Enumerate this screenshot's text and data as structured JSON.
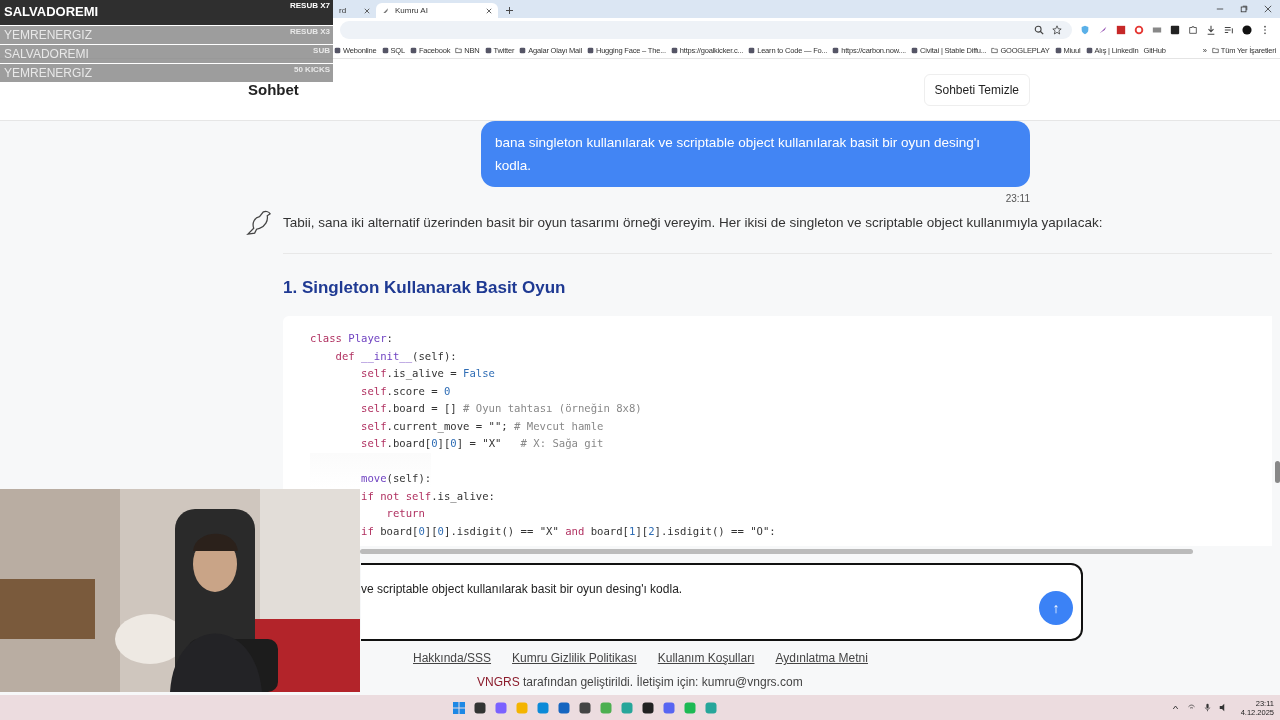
{
  "browser": {
    "tabs": [
      {
        "label": "rd",
        "selected": false
      },
      {
        "label": "Kumru AI",
        "selected": true
      }
    ],
    "bookmarks": [
      {
        "label": "Webonline",
        "kind": "site"
      },
      {
        "label": "SQL",
        "kind": "site"
      },
      {
        "label": "Facebook",
        "kind": "site"
      },
      {
        "label": "NBN",
        "kind": "folder"
      },
      {
        "label": "Twitter",
        "kind": "site"
      },
      {
        "label": "Agalar Olayı Mail",
        "kind": "site"
      },
      {
        "label": "Hugging Face – The...",
        "kind": "site"
      },
      {
        "label": "https://goalkicker.c...",
        "kind": "site"
      },
      {
        "label": "Learn to Code — Fo...",
        "kind": "site"
      },
      {
        "label": "https://carbon.now....",
        "kind": "site"
      },
      {
        "label": "Civitai | Stable Diffu...",
        "kind": "site"
      },
      {
        "label": "GOOGLEPLAY",
        "kind": "folder"
      },
      {
        "label": "Miuul",
        "kind": "site"
      },
      {
        "label": "Alış | LinkedIn",
        "kind": "site"
      },
      {
        "label": "GitHub",
        "kind": "plain"
      }
    ],
    "more": "»",
    "all_bookmarks": "Tüm Yer İşaretleri"
  },
  "overlay": [
    {
      "name": "SALVADOREMI",
      "event": "RESUB X7",
      "kind": "top"
    },
    {
      "name": "YEMRENERGIZ",
      "event": "RESUB X3",
      "kind": "faded"
    },
    {
      "name": "SALVADOREMI",
      "event": "SUB",
      "kind": "faded"
    },
    {
      "name": "YEMRENERGIZ",
      "event": "50 KICKS",
      "kind": "faded"
    }
  ],
  "header": {
    "title": "Sohbet",
    "clear_button": "Sohbeti Temizle"
  },
  "chat": {
    "user_message": "bana singleton kullanılarak ve scriptable object kullanılarak basit bir oyun desing'ı kodla.",
    "time": "23:11",
    "reply": "Tabii, sana iki alternatif üzerinden basit bir oyun tasarımı örneği vereyim. Her ikisi de singleton ve scriptable object kullanımıyla yapılacak:",
    "heading": "1. Singleton Kullanarak Basit Oyun",
    "code": [
      {
        "blank_before": false,
        "tokens": [
          {
            "text": "class ",
            "kind": "kw"
          },
          {
            "text": "Player",
            "kind": "name"
          },
          {
            "text": ":",
            "kind": "plain"
          }
        ]
      },
      {
        "blank_before": false,
        "tokens": [
          {
            "text": "    def ",
            "kind": "kw"
          },
          {
            "text": "__init__",
            "kind": "name"
          },
          {
            "text": "(self):",
            "kind": "plain"
          }
        ]
      },
      {
        "blank_before": false,
        "tokens": [
          {
            "text": "        self",
            "kind": "self"
          },
          {
            "text": ".is_alive = ",
            "kind": "plain"
          },
          {
            "text": "False",
            "kind": "const"
          }
        ]
      },
      {
        "blank_before": false,
        "tokens": [
          {
            "text": "        self",
            "kind": "self"
          },
          {
            "text": ".score = ",
            "kind": "plain"
          },
          {
            "text": "0",
            "kind": "const"
          }
        ]
      },
      {
        "blank_before": false,
        "tokens": [
          {
            "text": "        self",
            "kind": "self"
          },
          {
            "text": ".board = [] ",
            "kind": "plain"
          },
          {
            "text": "# Oyun tahtası (örneğin 8x8)",
            "kind": "com"
          }
        ]
      },
      {
        "blank_before": false,
        "tokens": [
          {
            "text": "        self",
            "kind": "self"
          },
          {
            "text": ".current_move = \"\"; ",
            "kind": "plain"
          },
          {
            "text": "# Mevcut hamle",
            "kind": "com"
          }
        ]
      },
      {
        "blank_before": false,
        "tokens": [
          {
            "text": "        self",
            "kind": "self"
          },
          {
            "text": ".board[",
            "kind": "plain"
          },
          {
            "text": "0",
            "kind": "const"
          },
          {
            "text": "][",
            "kind": "plain"
          },
          {
            "text": "0",
            "kind": "const"
          },
          {
            "text": "] = \"X\"   ",
            "kind": "plain"
          },
          {
            "text": "# X: Sağa git",
            "kind": "com"
          }
        ]
      },
      {
        "blank_before": true,
        "tokens": [
          {
            "text": "        move",
            "kind": "name"
          },
          {
            "text": "(self):",
            "kind": "plain"
          }
        ]
      },
      {
        "blank_before": false,
        "tokens": [
          {
            "text": "        if not ",
            "kind": "kw"
          },
          {
            "text": "self",
            "kind": "self"
          },
          {
            "text": ".is_alive:",
            "kind": "plain"
          }
        ]
      },
      {
        "blank_before": false,
        "tokens": [
          {
            "text": "            return",
            "kind": "kw"
          }
        ]
      },
      {
        "blank_before": false,
        "tokens": [
          {
            "text": "        if ",
            "kind": "kw"
          },
          {
            "text": "board[",
            "kind": "plain"
          },
          {
            "text": "0",
            "kind": "const"
          },
          {
            "text": "][",
            "kind": "plain"
          },
          {
            "text": "0",
            "kind": "const"
          },
          {
            "text": "].isdigit() == \"X\" ",
            "kind": "plain"
          },
          {
            "text": "and ",
            "kind": "kw"
          },
          {
            "text": "board[",
            "kind": "plain"
          },
          {
            "text": "1",
            "kind": "const"
          },
          {
            "text": "][",
            "kind": "plain"
          },
          {
            "text": "2",
            "kind": "const"
          },
          {
            "text": "].isdigit() == \"O\":",
            "kind": "plain"
          }
        ]
      }
    ]
  },
  "composer": {
    "value": "ve scriptable object kullanılarak basit bir oyun desing'ı kodla.",
    "send": "↑"
  },
  "footer": {
    "links": [
      "Hakkında/SSS",
      "Kumru Gizlilik Politikası",
      "Kullanım Koşulları",
      "Aydınlatma Metni"
    ],
    "brand": "VNGRS",
    "credit": " tarafından geliştirildi. İletişim için: kumru@vngrs.com"
  },
  "taskbar": {
    "time": "23:11",
    "date": "4.12.2025"
  }
}
